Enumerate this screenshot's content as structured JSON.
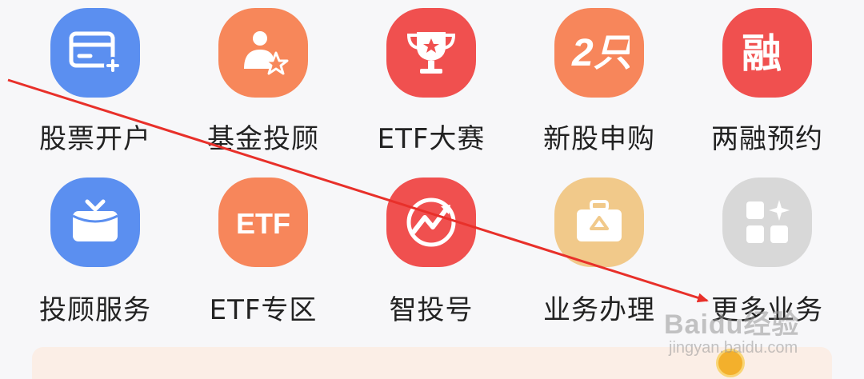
{
  "grid": {
    "row1": [
      {
        "label": "股票开户",
        "icon": "card-plus-icon",
        "color": "#5b8ff0"
      },
      {
        "label": "基金投顾",
        "icon": "advisor-star-icon",
        "color": "#f7875a"
      },
      {
        "label": "ETF大赛",
        "icon": "trophy-icon",
        "color": "#f0504f"
      },
      {
        "label": "新股申购",
        "icon": "ipo-icon",
        "color": "#f7865b"
      },
      {
        "label": "两融预约",
        "icon": "margin-icon",
        "color": "#f0504f"
      }
    ],
    "row2": [
      {
        "label": "投顾服务",
        "icon": "inbox-check-icon",
        "color": "#5b8ff0"
      },
      {
        "label": "ETF专区",
        "icon": "etf-icon",
        "color": "#f7865b",
        "icon_text": "ETF"
      },
      {
        "label": "智投号",
        "icon": "smart-invest-icon",
        "color": "#f0504f"
      },
      {
        "label": "业务办理",
        "icon": "briefcase-icon",
        "color": "#f1c98a"
      },
      {
        "label": "更多业务",
        "icon": "more-grid-icon",
        "color": "#d8d8d8"
      }
    ]
  },
  "ipo_icon_text": "2只",
  "margin_icon_text": "融",
  "arrow_color": "#e8302a",
  "watermark": {
    "brand": "Baidu经验",
    "domain": "jingyan.baidu.com"
  }
}
